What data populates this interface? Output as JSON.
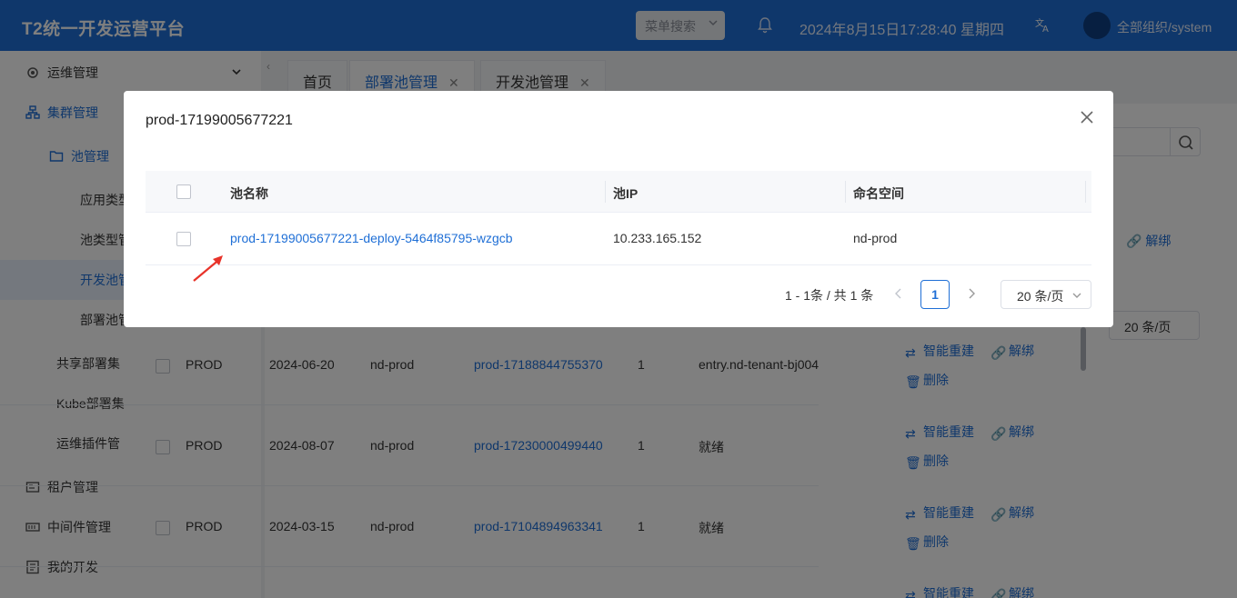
{
  "header": {
    "app_title": "T2统一开发运营平台",
    "menu_search": "菜单搜索",
    "datetime": "2024年8月15日17:28:40 星期四",
    "org": "全部组织/system"
  },
  "sidebar": {
    "items": [
      {
        "label": "运维管理",
        "icon": "ops-icon"
      },
      {
        "label": "集群管理",
        "icon": "cluster-icon"
      },
      {
        "label": "池管理",
        "icon": "folder-icon"
      },
      {
        "label": "应用类型"
      },
      {
        "label": "池类型管"
      },
      {
        "label": "开发池管"
      },
      {
        "label": "部署池管"
      },
      {
        "label": "共享部署集"
      },
      {
        "label": "Kube部署集"
      },
      {
        "label": "运维插件管"
      },
      {
        "label": "租户管理",
        "icon": "tenant-icon"
      },
      {
        "label": "中间件管理",
        "icon": "middleware-icon"
      },
      {
        "label": "我的开发",
        "icon": "dev-icon"
      }
    ]
  },
  "tabs": [
    {
      "label": "首页"
    },
    {
      "label": "部署池管理"
    },
    {
      "label": "开发池管理"
    }
  ],
  "background": {
    "per_page": "20 条/页",
    "unbind": "解绑",
    "rows": [
      {
        "env": "PROD",
        "date": "2024-06-20",
        "namespace": "nd-prod",
        "pool": "prod-17188844755370",
        "count": "1",
        "status": "entry.nd-tenant-bj004"
      },
      {
        "env": "PROD",
        "date": "2024-08-07",
        "namespace": "nd-prod",
        "pool": "prod-17230000499440",
        "count": "1",
        "status": "就绪"
      },
      {
        "env": "PROD",
        "date": "2024-03-15",
        "namespace": "nd-prod",
        "pool": "prod-17104894963341",
        "count": "1",
        "status": "就绪"
      }
    ],
    "actions": {
      "rebuild": "智能重建",
      "unbind": "解绑",
      "delete": "删除"
    }
  },
  "modal": {
    "title": "prod-17199005677221",
    "columns": {
      "name": "池名称",
      "ip": "池IP",
      "namespace": "命名空间"
    },
    "rows": [
      {
        "name": "prod-17199005677221-deploy-5464f85795-wzgcb",
        "ip": "10.233.165.152",
        "namespace": "nd-prod"
      }
    ],
    "pagination": {
      "total": "1 - 1条 / 共 1 条",
      "current_page": "1",
      "page_size": "20 条/页"
    }
  },
  "colors": {
    "primary": "#1f6fd6",
    "header_bg": "#1f6fd6",
    "annotation_arrow": "#e8332a"
  }
}
